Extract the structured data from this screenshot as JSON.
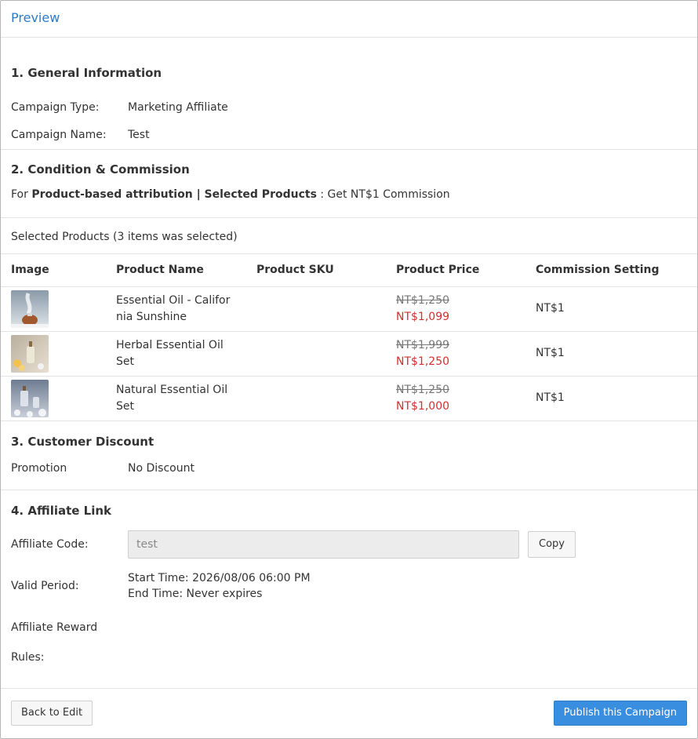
{
  "header": {
    "title": "Preview"
  },
  "general": {
    "title": "1. General Information",
    "campaign_type_label": "Campaign Type:",
    "campaign_type_value": "Marketing Affiliate",
    "campaign_name_label": "Campaign Name:",
    "campaign_name_value": "Test"
  },
  "condition": {
    "title": "2. Condition & Commission",
    "prefix": "For ",
    "bold_text": "Product-based attribution | Selected Products",
    "suffix": " : Get NT$1 Commission"
  },
  "selected": {
    "summary": "Selected Products (3 items was selected)"
  },
  "table": {
    "headers": [
      "Image",
      "Product Name",
      "Product SKU",
      "Product Price",
      "Commission Setting"
    ],
    "rows": [
      {
        "name": "Essential Oil - California Sunshine",
        "sku": "",
        "orig_price": "NT$1,250",
        "sale_price": "NT$1,099",
        "commission": "NT$1"
      },
      {
        "name": "Herbal Essential Oil Set",
        "sku": "",
        "orig_price": "NT$1,999",
        "sale_price": "NT$1,250",
        "commission": "NT$1"
      },
      {
        "name": "Natural Essential Oil Set",
        "sku": "",
        "orig_price": "NT$1,250",
        "sale_price": "NT$1,000",
        "commission": "NT$1"
      }
    ]
  },
  "discount": {
    "title": "3. Customer Discount",
    "promotion_label": "Promotion",
    "promotion_value": "No Discount"
  },
  "affiliate": {
    "title": "4. Affiliate Link",
    "code_label": "Affiliate Code:",
    "code_value": "test",
    "copy_label": "Copy",
    "valid_label": "Valid Period:",
    "start_time": "Start Time: 2026/08/06 06:00 PM",
    "end_time": "End Time: Never expires",
    "reward_label": "Affiliate Reward",
    "rules_label": "Rules:"
  },
  "footer": {
    "back_label": "Back to Edit",
    "publish_label": "Publish this Campaign"
  },
  "colors": {
    "accent": "#2a7cc7",
    "sale": "#d32f2f",
    "publish": "#3a8ee0"
  }
}
